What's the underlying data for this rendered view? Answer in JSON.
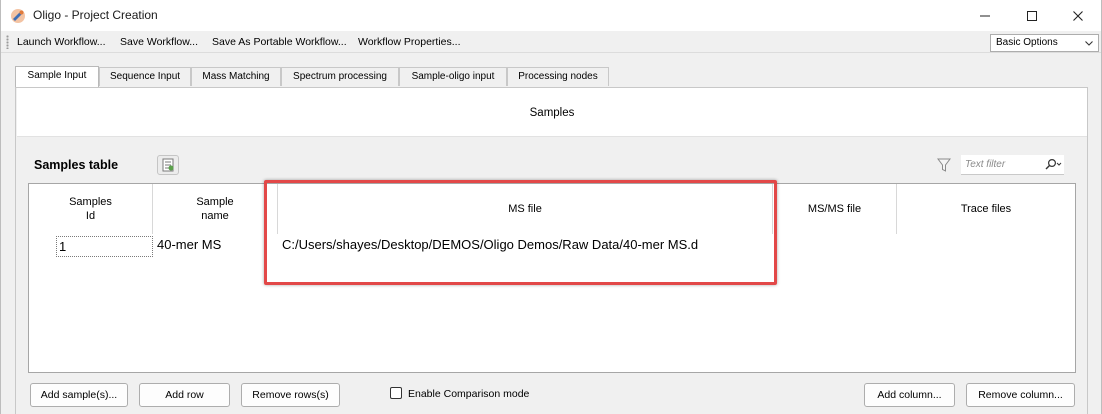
{
  "window": {
    "title": "Oligo - Project Creation"
  },
  "menubar": {
    "items": [
      "Launch Workflow...",
      "Save Workflow...",
      "Save As Portable Workflow...",
      "Workflow Properties..."
    ],
    "options_select": "Basic Options"
  },
  "tabs": [
    "Sample Input",
    "Sequence Input",
    "Mass Matching",
    "Spectrum processing",
    "Sample-oligo input",
    "Processing nodes"
  ],
  "active_tab": "Sample Input",
  "samples_section": {
    "title": "Samples",
    "table_title": "Samples table",
    "filter_placeholder": "Text filter"
  },
  "table": {
    "columns": [
      {
        "line1": "Samples",
        "line2": "Id"
      },
      {
        "line1": "Sample",
        "line2": "name"
      },
      {
        "line1": "MS file",
        "line2": ""
      },
      {
        "line1": "MS/MS file",
        "line2": ""
      },
      {
        "line1": "Trace files",
        "line2": ""
      }
    ],
    "rows": [
      {
        "id": "1",
        "name": "40-mer MS",
        "ms_file": "C:/Users/shayes/Desktop/DEMOS/Oligo Demos/Raw Data/40-mer MS.d",
        "msms_file": "",
        "trace_files": ""
      }
    ]
  },
  "buttons": {
    "add_samples": "Add sample(s)...",
    "add_row": "Add row",
    "remove_rows": "Remove rows(s)",
    "enable_comparison": "Enable Comparison mode",
    "add_column": "Add column...",
    "remove_column": "Remove column..."
  },
  "colors": {
    "highlight": "#e24848",
    "window_bg": "#f0f0f0"
  }
}
